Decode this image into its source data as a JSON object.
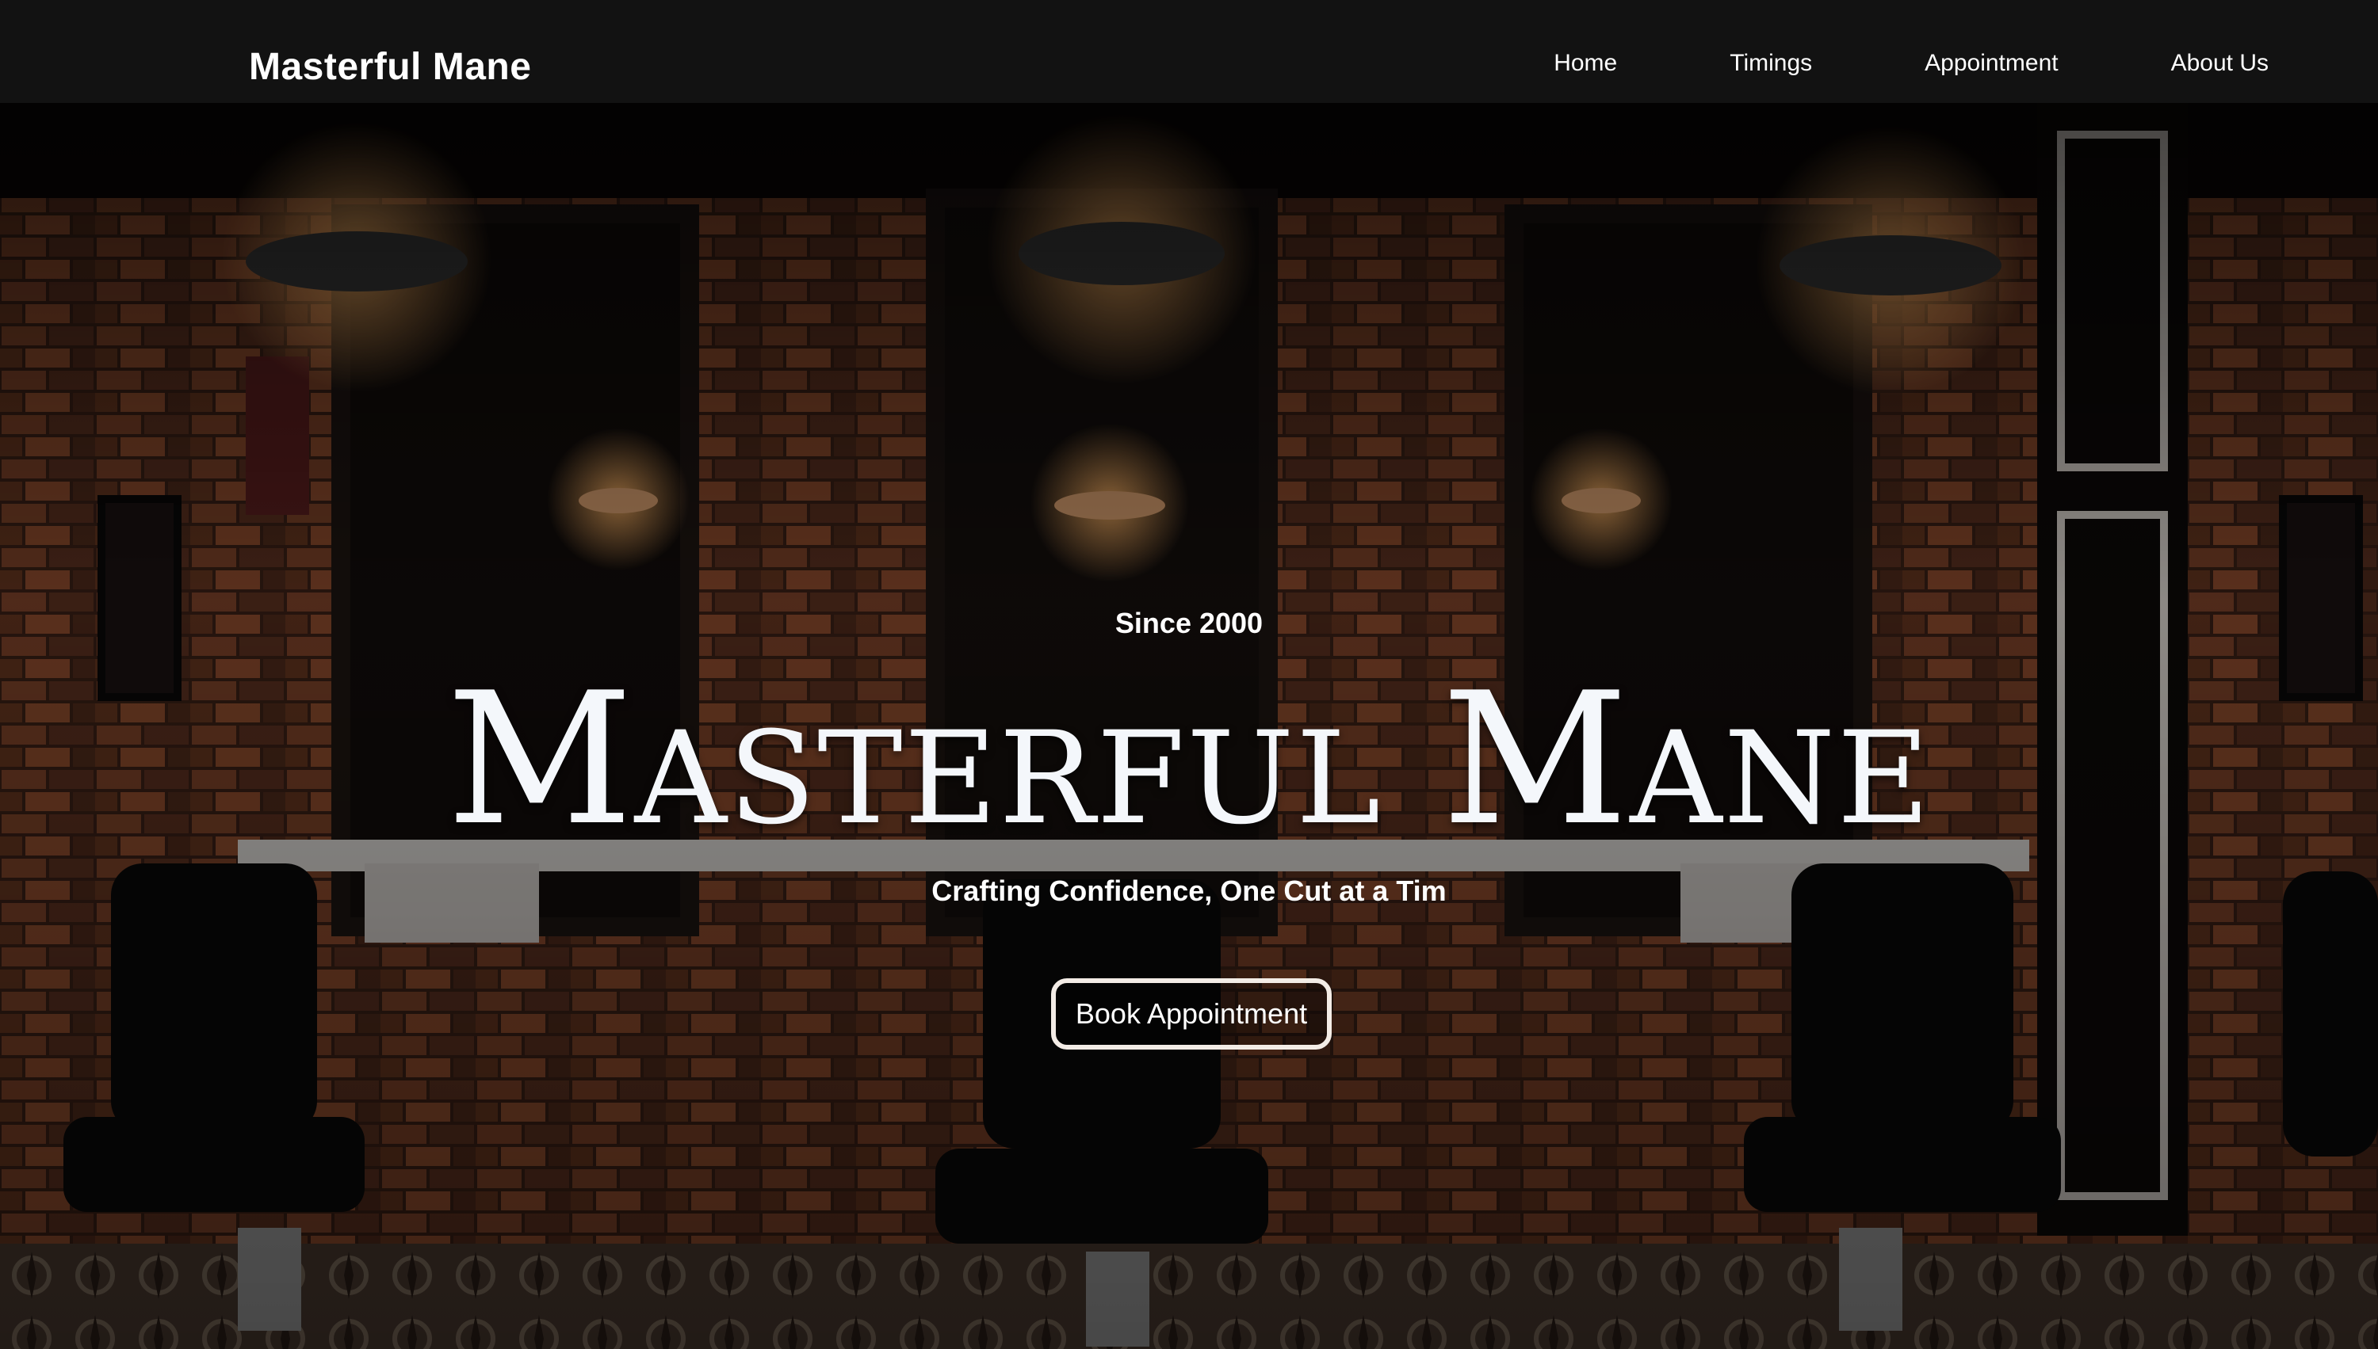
{
  "navbar": {
    "brand": "Masterful Mane",
    "links": [
      "Home",
      "Timings",
      "Appointment",
      "About Us"
    ]
  },
  "hero": {
    "since": "Since 2000",
    "title": "Masterful Mane",
    "tagline": "Crafting Confidence, One Cut at a Tim",
    "cta_label": "Book Appointment"
  },
  "colors": {
    "navbar_bg": "#121212",
    "text": "#ffffff",
    "cta_border": "#f3ece6",
    "brick": "#6b3a22"
  }
}
